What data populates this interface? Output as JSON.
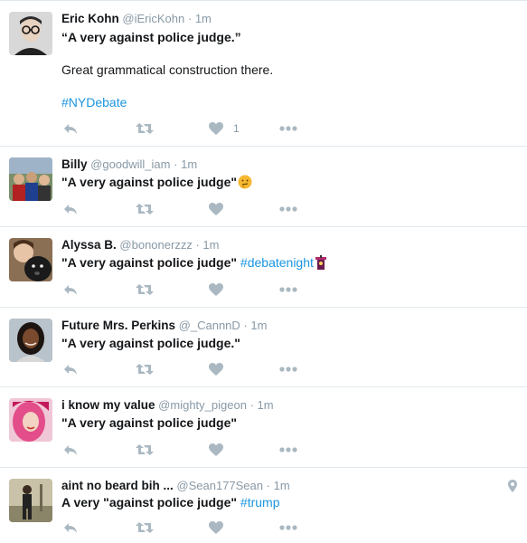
{
  "tweets": [
    {
      "name": "Eric Kohn",
      "handle": "@iEricKohn",
      "separator": "·",
      "time": "1m",
      "line1": "“A very against police judge.”",
      "line2": "Great grammatical construction there.",
      "hashtag": "#NYDebate",
      "like_count": "1",
      "avatar_icon": "man-with-glasses-avatar"
    },
    {
      "name": "Billy",
      "handle": "@goodwill_iam",
      "separator": "·",
      "time": "1m",
      "text": "\"A very against police judge\"",
      "emoji": "thinking-face-emoji",
      "avatar_icon": "group-photo-avatar"
    },
    {
      "name": "Alyssa B.",
      "handle": "@bononerzzz",
      "separator": "·",
      "time": "1m",
      "text": "\"A very against police judge\"",
      "hashtag": "#debatenight",
      "emoji": "podium-emoji",
      "avatar_icon": "selfie-with-dog-avatar"
    },
    {
      "name": "Future Mrs. Perkins",
      "handle": "@_CannnD",
      "separator": "·",
      "time": "1m",
      "text": "\"A very against police judge.\"",
      "avatar_icon": "woman-portrait-avatar"
    },
    {
      "name": "i know my value",
      "handle": "@mighty_pigeon",
      "separator": "·",
      "time": "1m",
      "text": "\"A very against police judge\"",
      "avatar_icon": "pink-hair-avatar"
    },
    {
      "name": "aint no beard bih ...",
      "handle": "@Sean177Sean",
      "separator": "·",
      "time": "1m",
      "text": "A very \"against police judge\"",
      "hashtag": "#trump",
      "avatar_icon": "person-outdoors-avatar",
      "location_icon": "location-pin-icon"
    }
  ],
  "icons": {
    "reply": "reply-icon",
    "retweet": "retweet-icon",
    "like": "heart-icon",
    "more": "more-dots-icon"
  },
  "colors": {
    "text": "#14171a",
    "muted": "#8899a6",
    "link": "#1b95e0",
    "action": "#aab8c2",
    "divider": "#e1e8ed"
  }
}
